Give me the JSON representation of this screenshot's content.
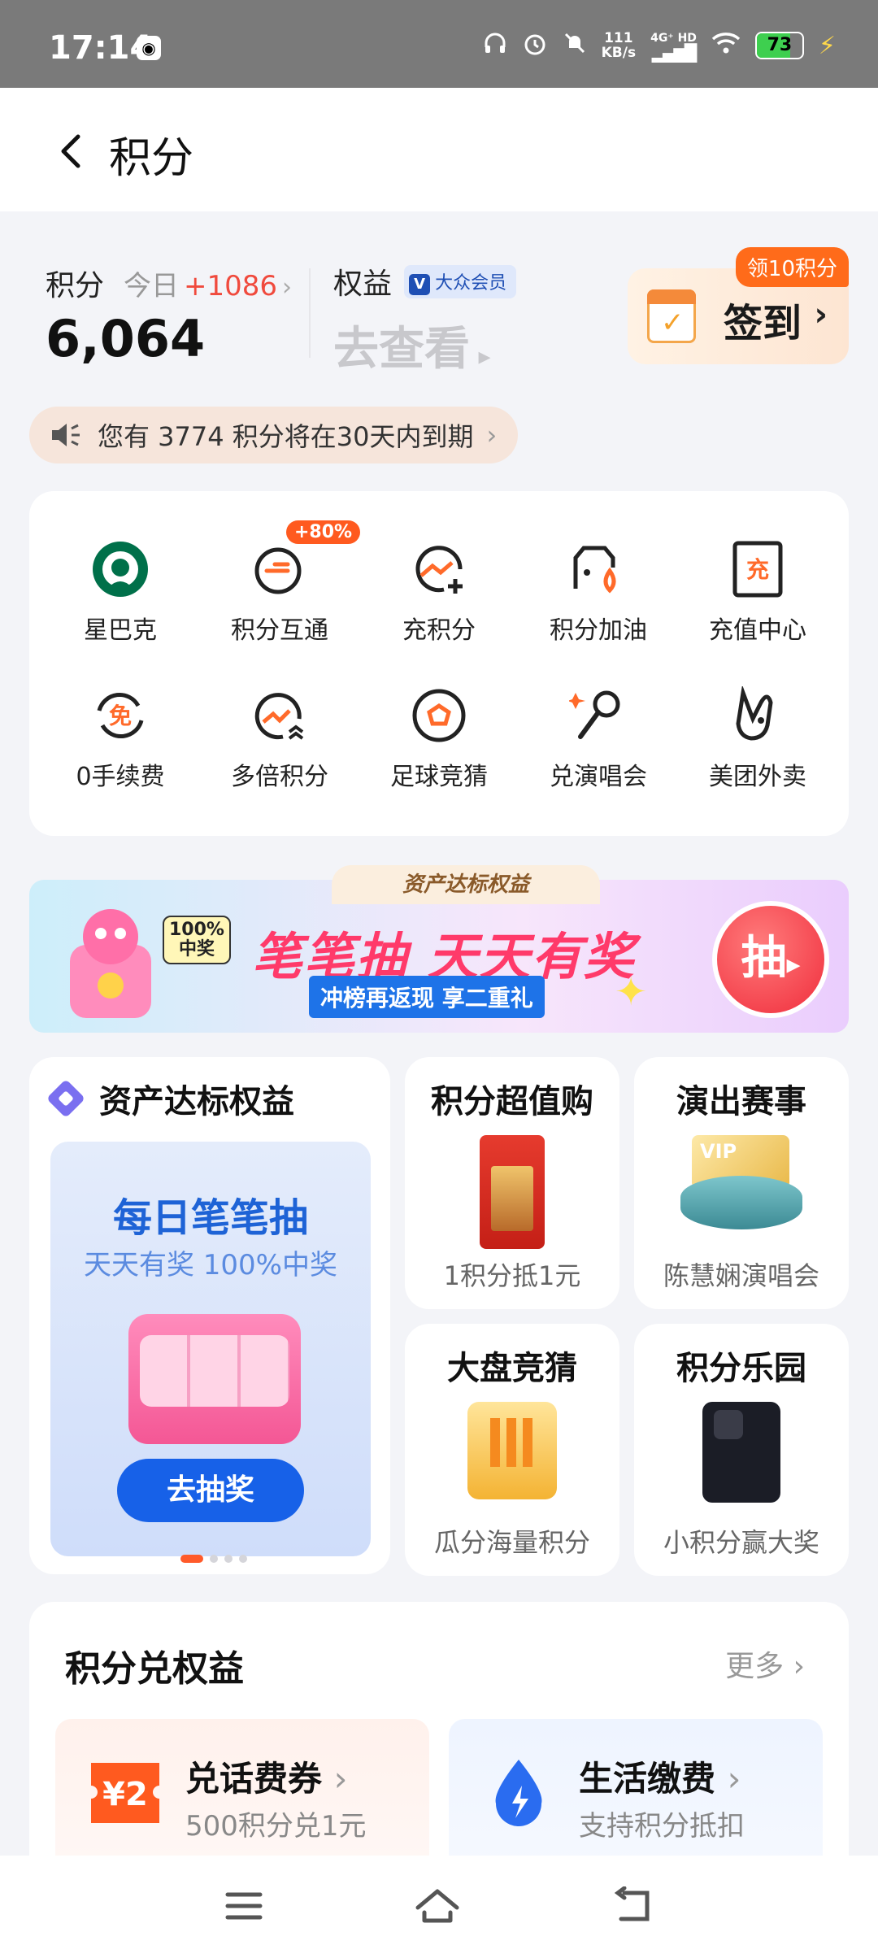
{
  "status_bar": {
    "time": "17:14",
    "net_speed_value": "111",
    "net_speed_unit": "KB/s",
    "signal_label": "4G⁺ HD",
    "battery": "73",
    "icons": [
      "qq-icon",
      "headphones-icon",
      "alarm-icon",
      "mute-icon",
      "signal-icon",
      "wifi-icon",
      "battery-icon",
      "charging-icon"
    ]
  },
  "header": {
    "title": "积分",
    "back_icon": "chevron-left-icon"
  },
  "summary": {
    "points_label": "积分",
    "today_label": "今日",
    "today_delta": "+1086",
    "points_value": "6,064",
    "rights_label": "权益",
    "member_badge": "大众会员",
    "member_badge_icon": "V",
    "rights_cta": "去查看",
    "checkin_tag": "领10积分",
    "checkin_label": "签到"
  },
  "notice": {
    "text": "您有 3774 积分将在30天内到期"
  },
  "services": [
    {
      "label": "星巴克",
      "icon": "starbucks-icon"
    },
    {
      "label": "积分互通",
      "icon": "points-exchange-icon",
      "badge": "+80%"
    },
    {
      "label": "充积分",
      "icon": "add-points-icon"
    },
    {
      "label": "积分加油",
      "icon": "fuel-icon"
    },
    {
      "label": "充值中心",
      "icon": "recharge-icon",
      "icon_char": "充"
    },
    {
      "label": "0手续费",
      "icon": "fee-free-icon",
      "icon_char": "免"
    },
    {
      "label": "多倍积分",
      "icon": "multiply-points-icon"
    },
    {
      "label": "足球竞猜",
      "icon": "football-icon"
    },
    {
      "label": "兑演唱会",
      "icon": "microphone-icon"
    },
    {
      "label": "美团外卖",
      "icon": "meituan-icon"
    }
  ],
  "banner": {
    "tab": "资产达标权益",
    "badge": "100%\n中奖",
    "title": "笔笔抽 天天有奖",
    "subtitle": "冲榜再返现 享二重礼",
    "draw_button": "抽"
  },
  "asset_card": {
    "title": "资产达标权益",
    "heading": "每日笔笔抽",
    "subheading": "天天有奖 100%中奖",
    "button": "去抽奖"
  },
  "promo_cards": [
    {
      "title": "积分超值购",
      "desc": "1积分抵1元"
    },
    {
      "title": "演出赛事",
      "desc": "陈慧娴演唱会",
      "image_text": "VIP"
    },
    {
      "title": "大盘竞猜",
      "desc": "瓜分海量积分"
    },
    {
      "title": "积分乐园",
      "desc": "小积分赢大奖"
    }
  ],
  "exchange": {
    "title": "积分兑权益",
    "more": "更多",
    "items": [
      {
        "title": "兑话费券",
        "desc": "500积分兑1元",
        "icon_text": "¥2",
        "color": "#ff5a1f"
      },
      {
        "title": "生活缴费",
        "desc": "支持积分抵扣",
        "color": "#2a6cf0"
      }
    ]
  },
  "bottom_nav": [
    "menu-icon",
    "home-icon",
    "back-icon"
  ]
}
